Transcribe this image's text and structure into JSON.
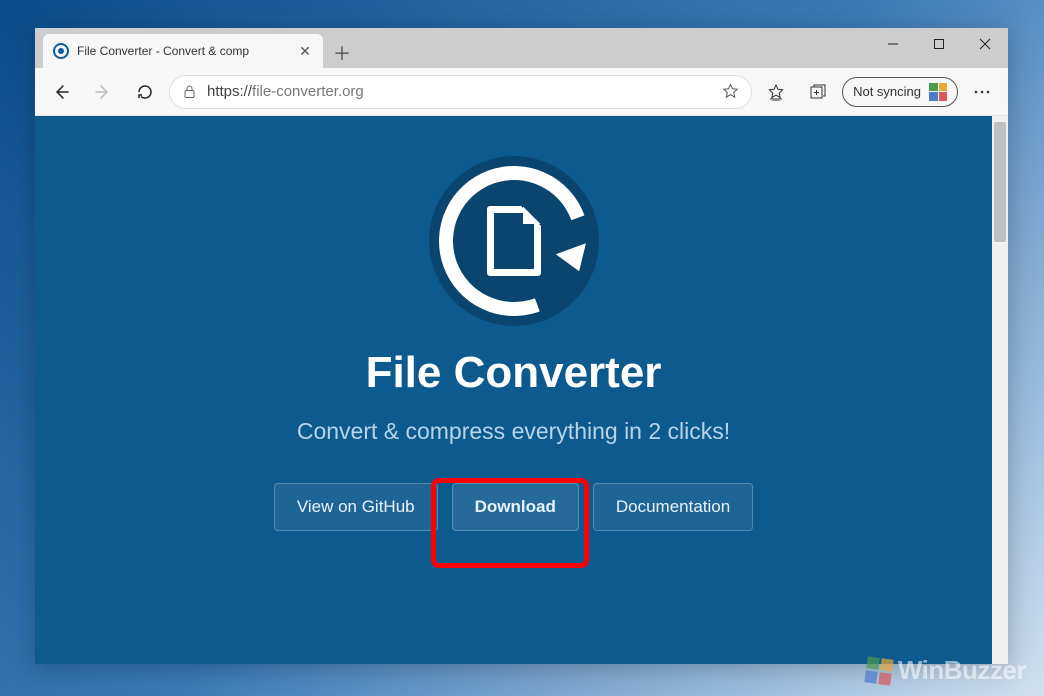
{
  "tab": {
    "title": "File Converter - Convert & comp"
  },
  "address": {
    "scheme": "https://",
    "host": "file-converter.org"
  },
  "sync": {
    "label": "Not syncing"
  },
  "page": {
    "title": "File Converter",
    "tagline": "Convert & compress everything in 2 clicks!",
    "buttons": {
      "github": "View on GitHub",
      "download": "Download",
      "docs": "Documentation"
    }
  },
  "watermark": "WinBuzzer"
}
